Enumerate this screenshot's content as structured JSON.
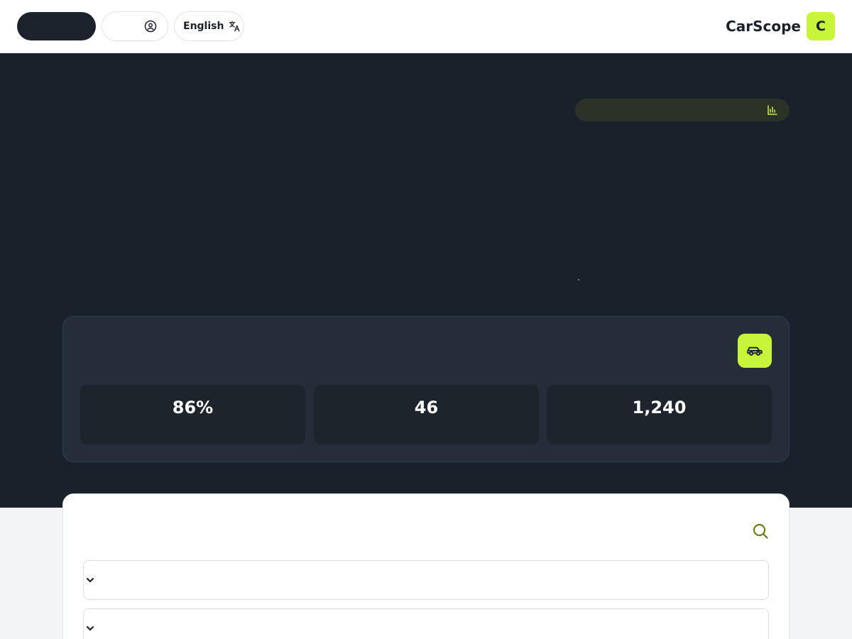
{
  "header": {
    "language_label": "English",
    "brand_name": "CarScope",
    "brand_initial": "C"
  },
  "stats": {
    "items": [
      {
        "value": "86%"
      },
      {
        "value": "46"
      },
      {
        "value": "1,240"
      }
    ]
  },
  "colors": {
    "accent": "#c8f53a",
    "hero_bg": "#19212b",
    "card_bg": "#252e38",
    "stat_bg": "#1e242c",
    "page_bg": "#f2f4f6"
  },
  "icons": {
    "account": "user-circle-icon",
    "language": "translate-icon",
    "chart": "bar-chart-icon",
    "car": "car-icon",
    "search": "search-icon",
    "chevron": "chevron-down-icon"
  }
}
